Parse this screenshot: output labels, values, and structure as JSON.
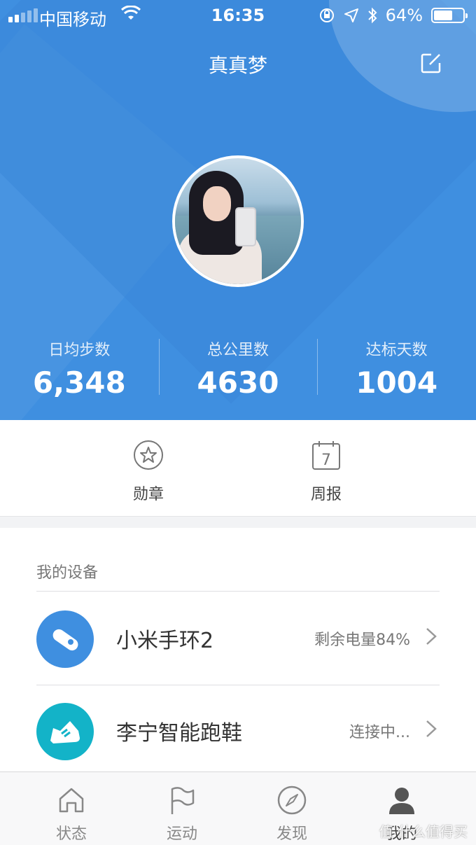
{
  "status_bar": {
    "carrier": "中国移动",
    "time": "16:35",
    "battery": "64%",
    "battery_level": 0.64
  },
  "header": {
    "title": "真真梦"
  },
  "stats": [
    {
      "label": "日均步数",
      "value": "6,348"
    },
    {
      "label": "总公里数",
      "value": "4630"
    },
    {
      "label": "达标天数",
      "value": "1004"
    }
  ],
  "quick_actions": [
    {
      "label": "勋章",
      "icon": "star-badge-icon"
    },
    {
      "label": "周报",
      "icon": "calendar-icon",
      "day": "7"
    }
  ],
  "devices": {
    "section_title": "我的设备",
    "items": [
      {
        "name": "小米手环2",
        "status": "剩余电量84%",
        "icon": "band-icon",
        "color": "#3f8fe0"
      },
      {
        "name": "李宁智能跑鞋",
        "status": "连接中...",
        "icon": "shoe-icon",
        "color": "#13b3c8"
      }
    ]
  },
  "tabs": [
    {
      "label": "状态",
      "icon": "home-icon"
    },
    {
      "label": "运动",
      "icon": "flag-icon"
    },
    {
      "label": "发现",
      "icon": "compass-icon"
    },
    {
      "label": "我的",
      "icon": "user-icon",
      "active": true
    }
  ],
  "watermark": "值 什么值得买"
}
